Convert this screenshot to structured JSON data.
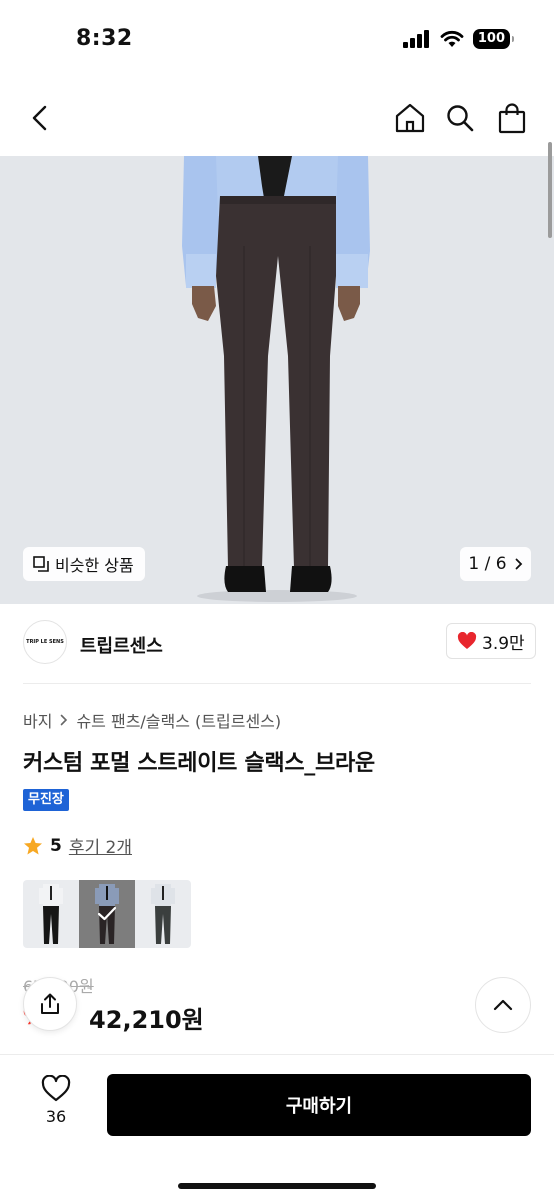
{
  "status": {
    "time": "8:32",
    "battery": "100"
  },
  "nav": {
    "back": "back-icon",
    "home": "home-icon",
    "search": "search-icon",
    "bag": "bag-icon"
  },
  "hero": {
    "similar_label": "비슷한 상품",
    "counter": "1 / 6",
    "colors": {
      "background": "#e3e6ea",
      "shirt": "#a9c4ee",
      "trousers": "#3a3132",
      "tie": "#1a1a1a"
    }
  },
  "brand": {
    "logo_text": "TRIP LE SENS",
    "name": "트립르센스",
    "likes": "3.9만"
  },
  "breadcrumb": [
    "바지",
    "슈트 팬츠/슬랙스 (트립르센스)"
  ],
  "product": {
    "title": "커스텀 포멀 스트레이트 슬랙스_브라운",
    "tag": "무진장",
    "rating": "5",
    "reviews": "후기 2개",
    "original_price": "67,900원",
    "discount": "%",
    "sale_price": "42,210원"
  },
  "thumbnails": [
    {
      "variant": "black",
      "selected": false
    },
    {
      "variant": "brown",
      "selected": true
    },
    {
      "variant": "gray",
      "selected": false
    }
  ],
  "bottom": {
    "wish_count": "36",
    "buy_label": "구매하기"
  },
  "colors": {
    "accent_blue": "#1e63d6",
    "discount_red": "#ff3b30",
    "heart_red": "#e8262d",
    "star": "#f7a823"
  }
}
